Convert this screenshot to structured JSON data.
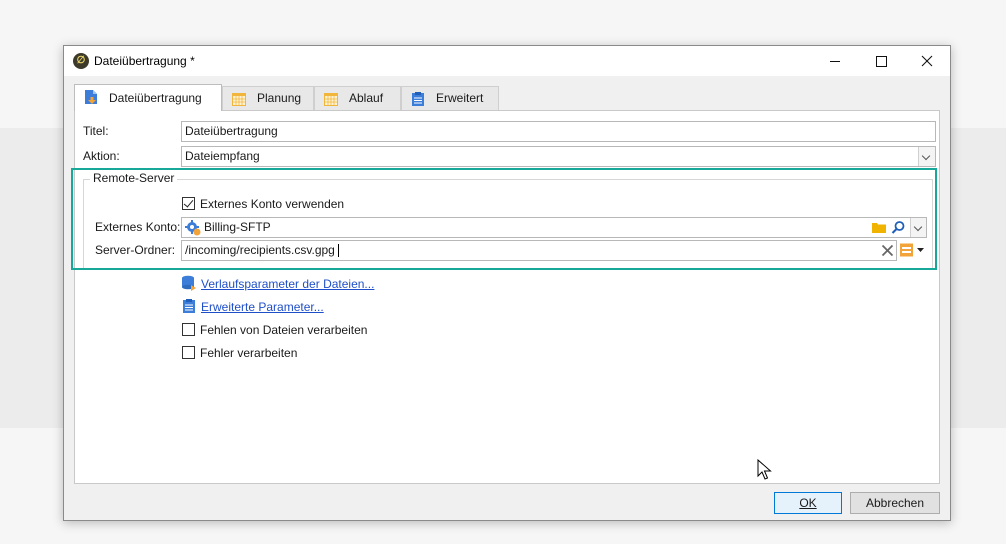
{
  "window": {
    "title": "Dateiübertragung *",
    "app_icon_glyph": "∅"
  },
  "tabs": [
    {
      "label": "Dateiübertragung",
      "icon": "file-transfer-icon",
      "active": true
    },
    {
      "label": "Planung",
      "icon": "calendar-icon",
      "active": false
    },
    {
      "label": "Ablauf",
      "icon": "calendar-icon",
      "active": false
    },
    {
      "label": "Erweitert",
      "icon": "clipboard-icon",
      "active": false
    }
  ],
  "form": {
    "title_label": "Titel:",
    "title_value": "Dateiübertragung",
    "action_label": "Aktion:",
    "action_value": "Dateiempfang"
  },
  "remote": {
    "group_title": "Remote-Server",
    "use_external_label": "Externes Konto verwenden",
    "use_external_checked": true,
    "account_label": "Externes Konto:",
    "account_value": "Billing-SFTP",
    "folder_label": "Server-Ordner:",
    "folder_value": "/incoming/recipients.csv.gpg"
  },
  "options": {
    "link_history": "Verlaufsparameter der Dateien...",
    "link_advanced": "Erweiterte Parameter...",
    "process_missing_label": "Fehlen von Dateien verarbeiten",
    "process_missing_checked": false,
    "process_errors_label": "Fehler verarbeiten",
    "process_errors_checked": false
  },
  "footer": {
    "ok_label": "OK",
    "cancel_label": "Abbrechen"
  },
  "colors": {
    "highlight": "#17a89a",
    "link": "#1f4fc8",
    "default_button_border": "#0078d7",
    "calendar_icon": "#f2b53c",
    "folder_icon": "#f0b400"
  }
}
